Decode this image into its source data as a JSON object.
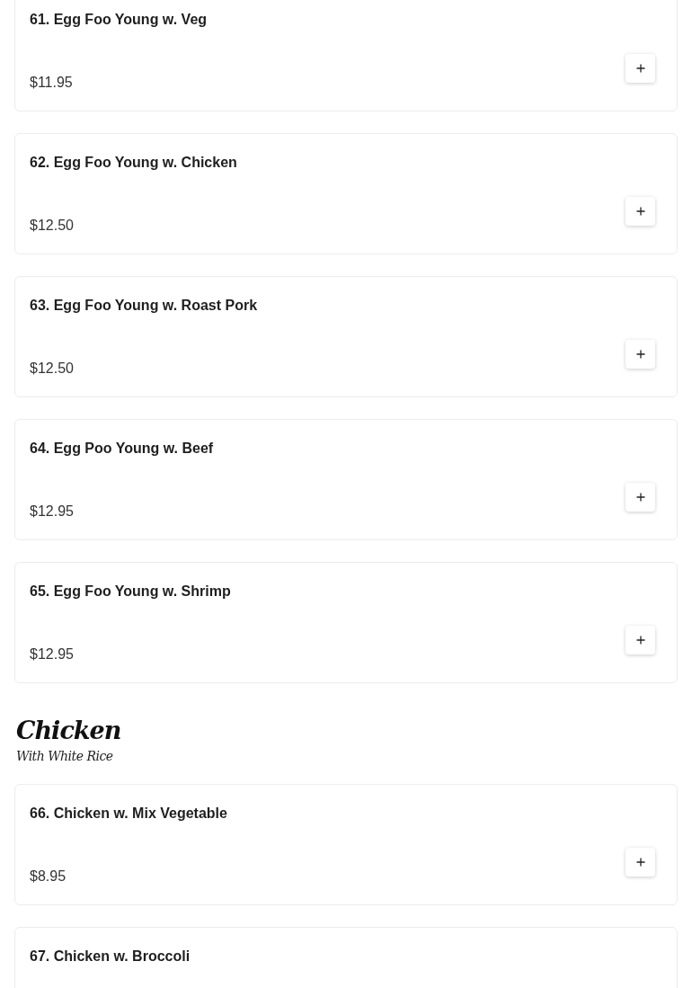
{
  "menu": [
    {
      "kind": "dish",
      "name": "61. Egg Foo Young w. Veg",
      "price": "$11.95"
    },
    {
      "kind": "dish",
      "name": "62. Egg Foo Young w. Chicken",
      "price": "$12.50"
    },
    {
      "kind": "dish",
      "name": "63. Egg Foo Young w. Roast Pork",
      "price": "$12.50"
    },
    {
      "kind": "dish",
      "name": "64. Egg Poo Young w. Beef",
      "price": "$12.95"
    },
    {
      "kind": "dish",
      "name": "65. Egg Foo Young w. Shrimp",
      "price": "$12.95"
    },
    {
      "kind": "section",
      "title": "Chicken",
      "subtitle": "With White Rice"
    },
    {
      "kind": "dish",
      "name": "66. Chicken w. Mix Vegetable",
      "price": "$8.95"
    },
    {
      "kind": "dish",
      "name": "67. Chicken w. Broccoli"
    }
  ]
}
